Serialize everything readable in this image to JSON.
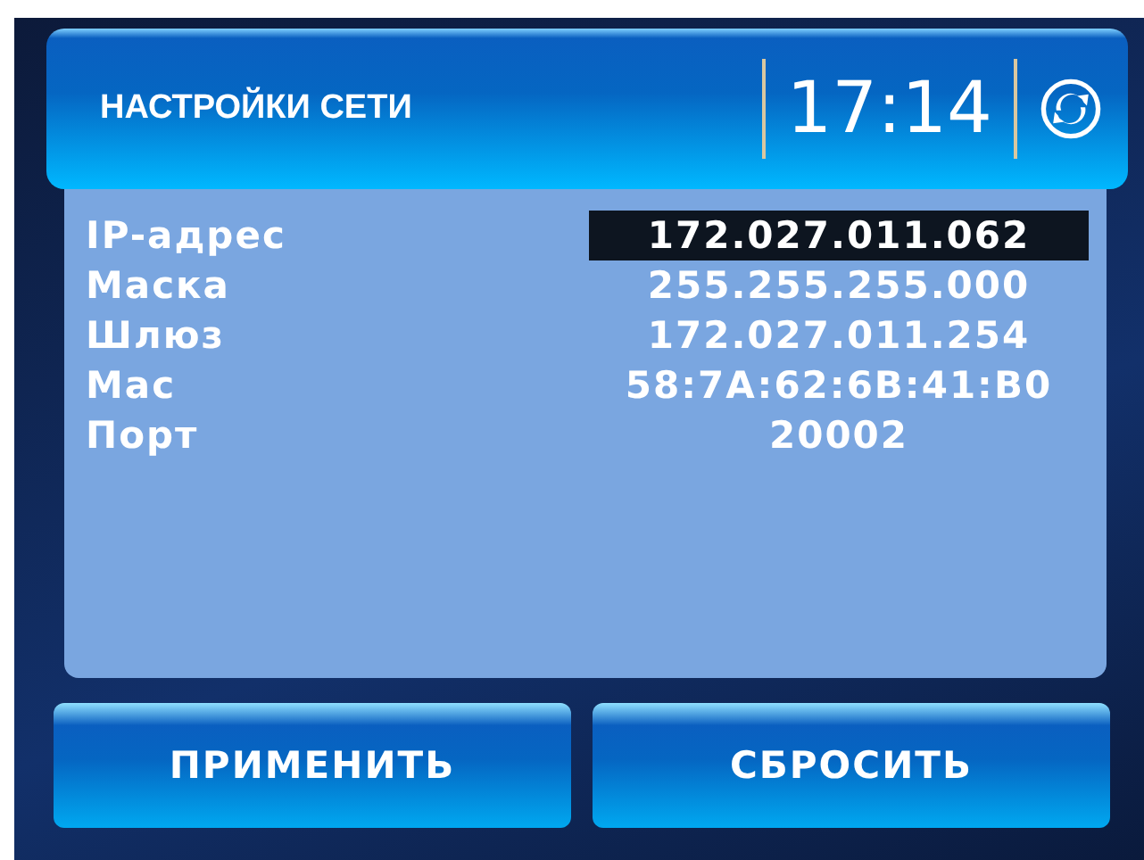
{
  "header": {
    "title": "НАСТРОЙКИ СЕТИ",
    "time": "17:14"
  },
  "fields": [
    {
      "label": "IP-адрес",
      "value": "172.027.011.062",
      "selected": true
    },
    {
      "label": "Маска",
      "value": "255.255.255.000",
      "selected": false
    },
    {
      "label": "Шлюз",
      "value": "172.027.011.254",
      "selected": false
    },
    {
      "label": "Mac",
      "value": "58:7A:62:6B:41:B0",
      "selected": false
    },
    {
      "label": "Порт",
      "value": "20002",
      "selected": false
    }
  ],
  "buttons": [
    "ПРИМЕНИТЬ",
    "СБРОСИТЬ"
  ]
}
